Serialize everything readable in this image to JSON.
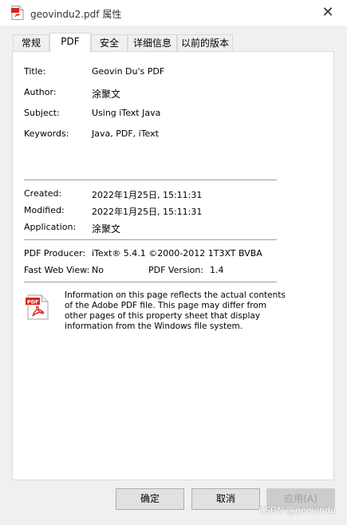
{
  "window": {
    "title": "geovindu2.pdf 属性",
    "close_glyph": "✕"
  },
  "tabs": [
    {
      "label": "常规"
    },
    {
      "label": "PDF"
    },
    {
      "label": "安全"
    },
    {
      "label": "详细信息"
    },
    {
      "label": "以前的版本"
    }
  ],
  "pdf": {
    "title_label": "Title:",
    "title_value": "Geovin Du's PDF",
    "author_label": "Author:",
    "author_value": "涂聚文",
    "subject_label": "Subject:",
    "subject_value": "Using iText Java",
    "keywords_label": "Keywords:",
    "keywords_value": "Java, PDF, iText",
    "created_label": "Created:",
    "created_value": "2022年1月25日, 15:11:31",
    "modified_label": "Modified:",
    "modified_value": "2022年1月25日, 15:11:31",
    "application_label": "Application:",
    "application_value": "涂聚文",
    "producer_label": "PDF Producer:",
    "producer_value": "iText® 5.4.1 ©2000-2012 1T3XT BVBA",
    "fastweb_label": "Fast Web View:",
    "fastweb_value": "No",
    "version_label": "PDF Version:",
    "version_value": "1.4",
    "info_text": "Information on this page reflects the actual contents of the Adobe PDF file. This page may differ from other pages of this property sheet that display information from the Windows file system."
  },
  "buttons": {
    "ok": "确定",
    "cancel": "取消",
    "apply": "应用(A)"
  },
  "watermark": "CSDN @geovindu",
  "colors": {
    "pdf_red": "#d9261c",
    "panel_bg": "#ffffff",
    "dialog_bg": "#f0f0f0"
  }
}
